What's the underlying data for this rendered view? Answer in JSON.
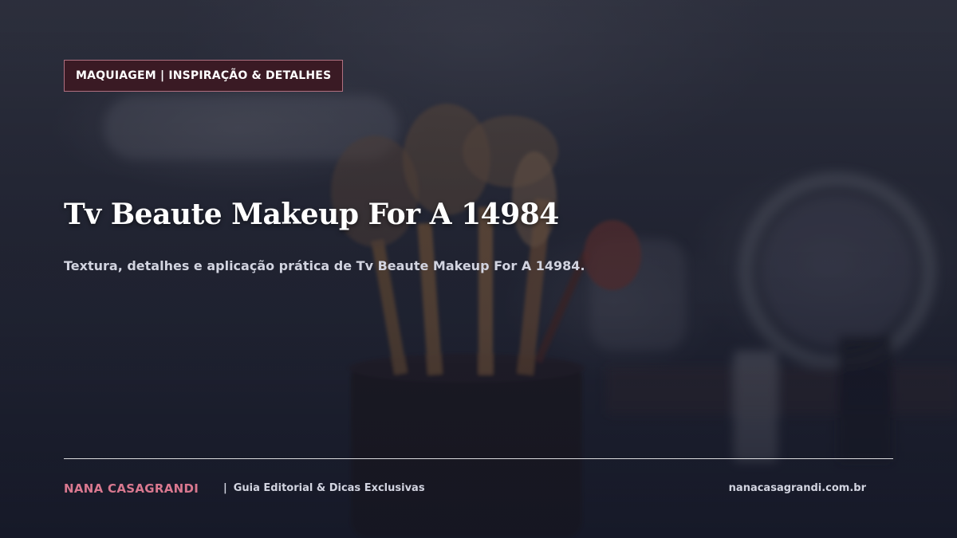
{
  "badge": {
    "label": "MAQUIAGEM | INSPIRAÇÃO & DETALHES"
  },
  "hero": {
    "title": "Tv Beaute Makeup For A 14984",
    "subtitle": "Textura, detalhes e aplicação prática de Tv Beaute Makeup For A 14984."
  },
  "footer": {
    "brand": "NANA CASAGRANDI",
    "separator": "|",
    "tagline": "Guia Editorial & Dicas Exclusivas",
    "site": "nanacasagrandi.com.br"
  },
  "colors": {
    "accent": "#d9788f",
    "badge_bg": "#3a1a24",
    "badge_border": "#b07080",
    "text_light": "#d2d4e0"
  }
}
